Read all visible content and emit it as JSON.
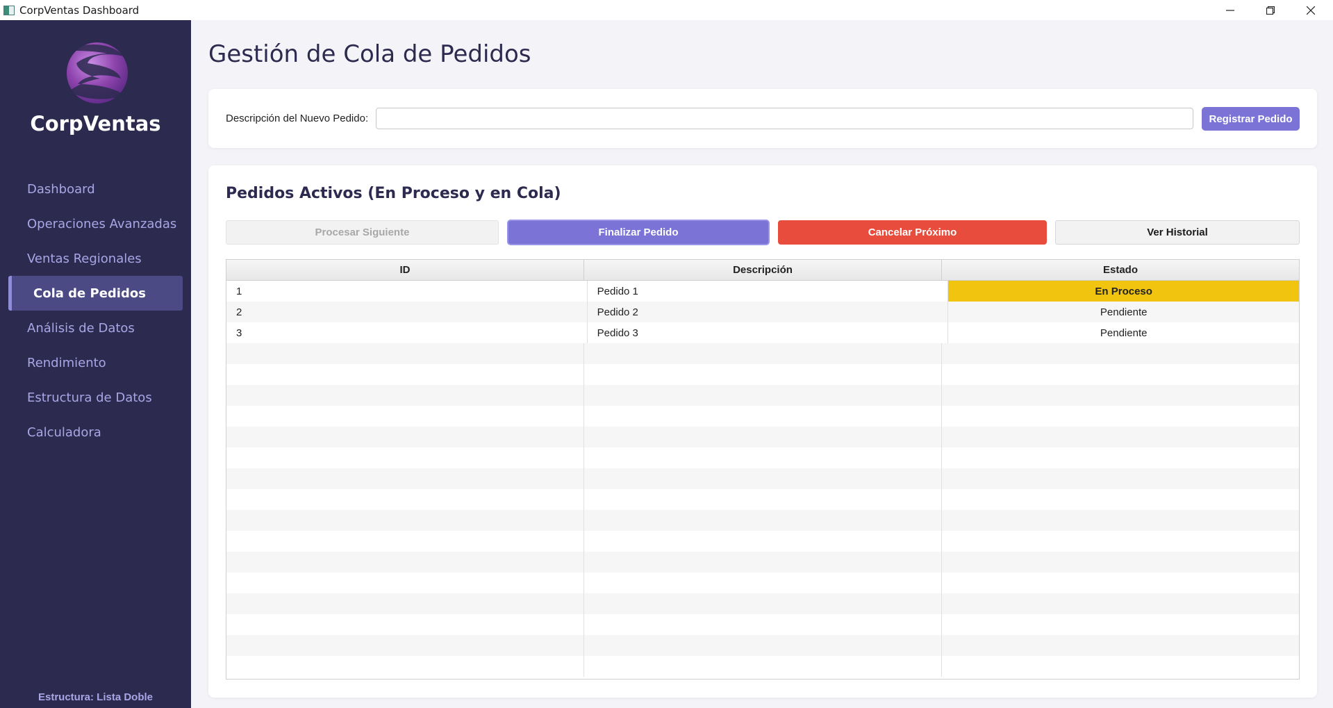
{
  "window": {
    "title": "CorpVentas Dashboard"
  },
  "sidebar": {
    "brand": "CorpVentas",
    "logo_icon": "corpventas-logo",
    "items": [
      {
        "label": "Dashboard"
      },
      {
        "label": "Operaciones Avanzadas"
      },
      {
        "label": "Ventas Regionales"
      },
      {
        "label": "Cola de Pedidos",
        "active": true
      },
      {
        "label": "Análisis de Datos"
      },
      {
        "label": "Rendimiento"
      },
      {
        "label": "Estructura de Datos"
      },
      {
        "label": "Calculadora"
      }
    ],
    "footer": "Estructura: Lista Doble"
  },
  "main": {
    "title": "Gestión de Cola de Pedidos",
    "new_order": {
      "label": "Descripción del Nuevo Pedido:",
      "value": "",
      "placeholder": "",
      "register_label": "Registrar Pedido"
    },
    "active_orders": {
      "title": "Pedidos Activos (En Proceso y en Cola)",
      "buttons": {
        "process_next": "Procesar Siguiente",
        "finish_order": "Finalizar Pedido",
        "cancel_next": "Cancelar Próximo",
        "view_history": "Ver Historial"
      },
      "table": {
        "columns": [
          "ID",
          "Descripción",
          "Estado"
        ],
        "rows": [
          {
            "id": "1",
            "description": "Pedido 1",
            "status": "En Proceso"
          },
          {
            "id": "2",
            "description": "Pedido 2",
            "status": "Pendiente"
          },
          {
            "id": "3",
            "description": "Pedido 3",
            "status": "Pendiente"
          }
        ]
      }
    }
  },
  "colors": {
    "sidebar_bg": "#2c2a4f",
    "accent": "#7b74d6",
    "danger": "#e74c3c",
    "processing": "#f1c40f"
  }
}
